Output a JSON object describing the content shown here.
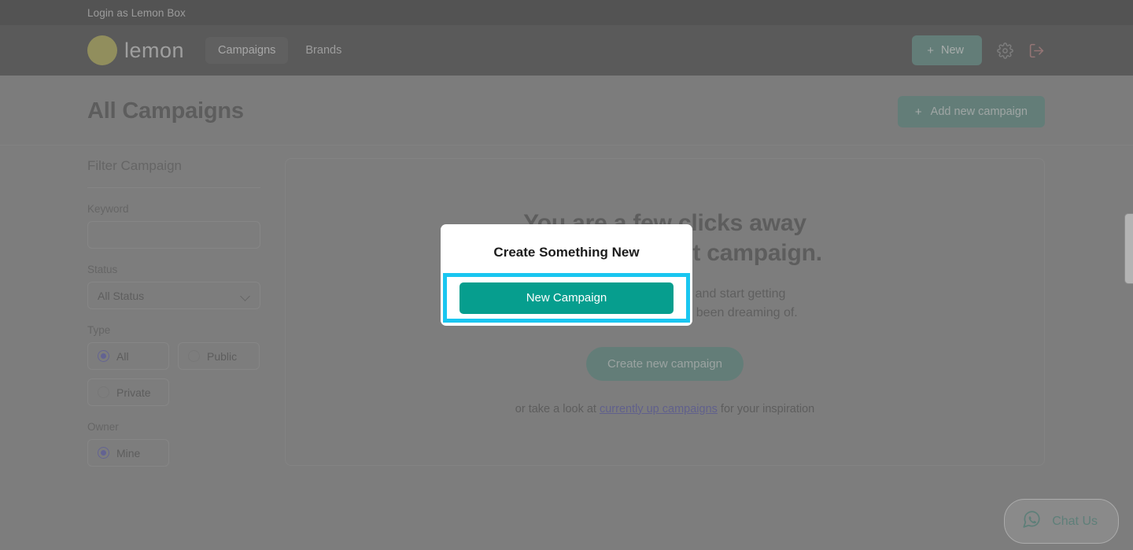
{
  "colors": {
    "accent_teal": "#069e8e",
    "nav_button_teal": "#6a9a91",
    "highlight_cyan": "#1ac6f0",
    "link_purple": "#6464b4",
    "logo_yellow": "#bdb860",
    "logout_red": "#c48a8a",
    "radio_checked": "#6b6bbf"
  },
  "login_bar": {
    "text": "Login as Lemon Box"
  },
  "nav": {
    "brand_name": "lemon",
    "brand_logo_icon": "lemon-circle-icon",
    "links": [
      {
        "label": "Campaigns",
        "active": true
      },
      {
        "label": "Brands",
        "active": false
      }
    ],
    "new_button": {
      "label": "New",
      "plus": "+",
      "icon": "plus-icon"
    },
    "settings_icon": "gear-icon",
    "logout_icon": "logout-icon"
  },
  "page_header": {
    "title": "All Campaigns",
    "add_button": {
      "label": "Add new campaign",
      "plus": "+",
      "icon": "plus-icon"
    }
  },
  "sidebar": {
    "title": "Filter Campaign",
    "keyword": {
      "label": "Keyword",
      "value": "",
      "placeholder": ""
    },
    "status": {
      "label": "Status",
      "selected": "All Status",
      "options": [
        "All Status"
      ],
      "chevron_icon": "chevron-down-icon"
    },
    "type": {
      "label": "Type",
      "options": [
        {
          "label": "All",
          "checked": true
        },
        {
          "label": "Public",
          "checked": false
        },
        {
          "label": "Private",
          "checked": false
        }
      ]
    },
    "owner": {
      "label": "Owner",
      "options": [
        {
          "label": "Mine",
          "checked": true
        }
      ]
    }
  },
  "main": {
    "heading_line1": "You are a few clicks away",
    "heading_line2": "from your perfect campaign.",
    "subtext_line1": "Create your first campaign and start getting",
    "subtext_line2": "that brand awareness you've been dreaming of.",
    "create_button_label": "Create new campaign",
    "footer_prefix": "or take a look at ",
    "footer_link": "currently up campaigns",
    "footer_suffix": " for your inspiration"
  },
  "chat_widget": {
    "label": "Chat Us",
    "icon": "whatsapp-icon"
  },
  "edge_handle": {
    "name": "side-panel-handle"
  },
  "modal": {
    "title": "Create Something New",
    "new_campaign_button": "New Campaign"
  }
}
